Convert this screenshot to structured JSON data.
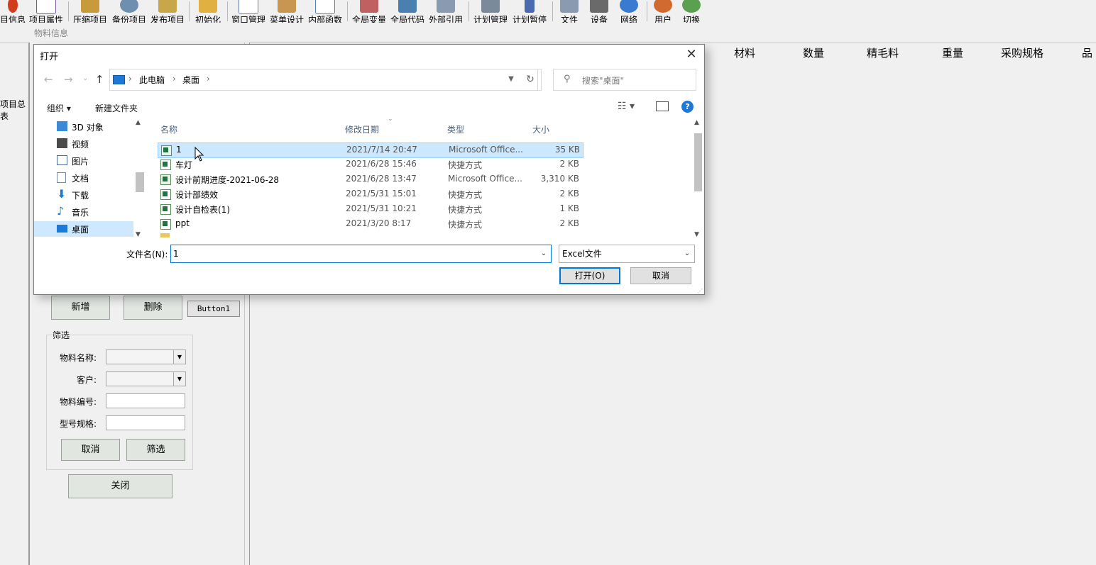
{
  "toolbar": {
    "items": [
      {
        "label": "目信息",
        "color": "#d23c1e"
      },
      {
        "label": "项目属性",
        "color": "#7a5a9a"
      },
      {
        "label": "压缩项目",
        "color": "#c79b3c"
      },
      {
        "label": "备份项目",
        "color": "#6f8fb0"
      },
      {
        "label": "发布项目",
        "color": "#c8a64a"
      },
      {
        "label": "初始化",
        "color": "#e0b040"
      },
      {
        "label": "窗口管理",
        "color": "#6a7fb5"
      },
      {
        "label": "菜单设计",
        "color": "#c89650"
      },
      {
        "label": "内部函数",
        "color": "#5a7fb5"
      },
      {
        "label": "全局变量",
        "color": "#c06060"
      },
      {
        "label": "全局代码",
        "color": "#4a7fb0"
      },
      {
        "label": "外部引用",
        "color": "#8a9ab0"
      },
      {
        "label": "计划管理",
        "color": "#7a8a9a"
      },
      {
        "label": "计划暂停",
        "color": "#4a6ab0"
      },
      {
        "label": "文件",
        "color": "#8a9ab0"
      },
      {
        "label": "设备",
        "color": "#6a6a6a"
      },
      {
        "label": "网络",
        "color": "#3a7ad0"
      },
      {
        "label": "用户",
        "color": "#d06a30"
      },
      {
        "label": "切换",
        "color": "#5aa050"
      }
    ]
  },
  "subbar": {
    "title": "物料信息"
  },
  "left_strip": {
    "tab_label": "项目总表"
  },
  "grid_headers": [
    "材料",
    "数量",
    "精毛料",
    "重量",
    "采购规格",
    "品"
  ],
  "left_panel": {
    "add_label": "新增",
    "delete_label": "删除",
    "button1_label": "Button1",
    "filter": {
      "title": "筛选",
      "material_name_label": "物料名称:",
      "customer_label": "客户:",
      "material_code_label": "物料编号:",
      "model_spec_label": "型号规格:",
      "cancel_label": "取消",
      "filter_label": "筛选"
    },
    "close_label": "关闭"
  },
  "dialog": {
    "title": "打开",
    "close_glyph": "✕",
    "nav": {
      "back": "←",
      "forward": "→",
      "recent": "⌄",
      "up": "↑"
    },
    "breadcrumb": [
      "此电脑",
      "桌面"
    ],
    "search_placeholder": "搜索\"桌面\"",
    "organize_label": "组织 ▾",
    "new_folder_label": "新建文件夹",
    "tree": [
      {
        "label": "3D 对象",
        "icon": "cube-icon",
        "color": "#3a8ad8"
      },
      {
        "label": "视频",
        "icon": "film-icon",
        "color": "#4a4a4a"
      },
      {
        "label": "图片",
        "icon": "picture-icon",
        "color": "#4a6a9a"
      },
      {
        "label": "文档",
        "icon": "document-icon",
        "color": "#7a8aa0"
      },
      {
        "label": "下载",
        "icon": "download-icon",
        "color": "#1e78d7"
      },
      {
        "label": "音乐",
        "icon": "music-icon",
        "color": "#1e78d7"
      },
      {
        "label": "桌面",
        "icon": "desktop-icon",
        "color": "#1e78d7"
      }
    ],
    "columns": {
      "name": "名称",
      "modified": "修改日期",
      "type": "类型",
      "size": "大小"
    },
    "files": [
      {
        "name": "1",
        "modified": "2021/7/14 20:47",
        "type": "Microsoft Office...",
        "size": "35 KB",
        "icon": "excel-icon"
      },
      {
        "name": "车灯",
        "modified": "2021/6/28 15:46",
        "type": "快捷方式",
        "size": "2 KB",
        "icon": "excel-shortcut-icon"
      },
      {
        "name": "设计前期进度-2021-06-28",
        "modified": "2021/6/28 13:47",
        "type": "Microsoft Office...",
        "size": "3,310 KB",
        "icon": "excel-icon"
      },
      {
        "name": "设计部绩效",
        "modified": "2021/5/31 15:01",
        "type": "快捷方式",
        "size": "2 KB",
        "icon": "excel-shortcut-icon"
      },
      {
        "name": "设计自检表(1)",
        "modified": "2021/5/31 10:21",
        "type": "快捷方式",
        "size": "1 KB",
        "icon": "excel-shortcut-icon"
      },
      {
        "name": "ppt",
        "modified": "2021/3/20 8:17",
        "type": "快捷方式",
        "size": "2 KB",
        "icon": "excel-shortcut-icon"
      }
    ],
    "filename_label": "文件名(N):",
    "filename_value": "1",
    "filetype_value": "Excel文件",
    "open_label": "打开(O)",
    "cancel_label": "取消"
  }
}
